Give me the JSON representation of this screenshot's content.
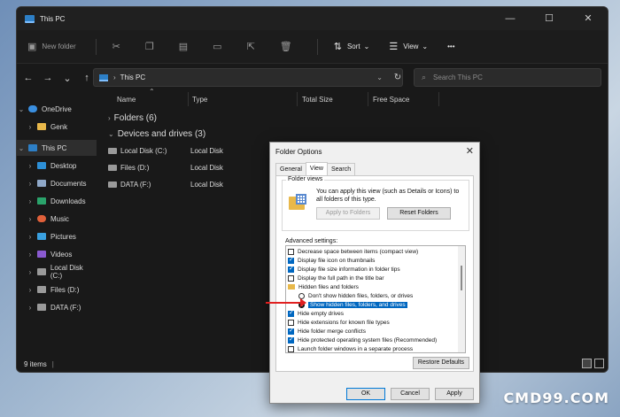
{
  "window": {
    "title": "This PC",
    "controls": [
      "—",
      "☐",
      "✕"
    ]
  },
  "toolbar": {
    "new_folder": "New folder",
    "sort": "Sort",
    "view": "View",
    "more": "•••"
  },
  "address": {
    "path": "This PC",
    "search_placeholder": "Search This PC"
  },
  "sidebar": {
    "items": [
      {
        "label": "OneDrive",
        "icon": "cloud-icon"
      },
      {
        "label": "Genk",
        "icon": "folder-icon"
      },
      {
        "label": "This PC",
        "icon": "computer-icon"
      },
      {
        "label": "Desktop",
        "icon": "desktop-icon"
      },
      {
        "label": "Documents",
        "icon": "documents-icon"
      },
      {
        "label": "Downloads",
        "icon": "download-icon"
      },
      {
        "label": "Music",
        "icon": "music-icon"
      },
      {
        "label": "Pictures",
        "icon": "pictures-icon"
      },
      {
        "label": "Videos",
        "icon": "videos-icon"
      },
      {
        "label": "Local Disk (C:)",
        "icon": "drive-icon"
      },
      {
        "label": "Files (D:)",
        "icon": "drive-icon"
      },
      {
        "label": "DATA (F:)",
        "icon": "drive-icon"
      }
    ]
  },
  "columns": {
    "name": "Name",
    "type": "Type",
    "total_size": "Total Size",
    "free_space": "Free Space"
  },
  "groups": {
    "folders": "Folders (6)",
    "drives": "Devices and drives (3)"
  },
  "drives": [
    {
      "name": "Local Disk (C:)",
      "type": "Local Disk"
    },
    {
      "name": "Files (D:)",
      "type": "Local Disk"
    },
    {
      "name": "DATA (F:)",
      "type": "Local Disk"
    }
  ],
  "status": {
    "items": "9 items"
  },
  "dialog": {
    "title": "Folder Options",
    "tabs": [
      "General",
      "View",
      "Search"
    ],
    "folder_views_legend": "Folder views",
    "folder_views_text": "You can apply this view (such as Details or Icons) to all folders of this type.",
    "apply_to_folders": "Apply to Folders",
    "reset_folders": "Reset Folders",
    "advanced_label": "Advanced settings:",
    "settings": [
      {
        "label": "Decrease space between items (compact view)",
        "kind": "checkbox",
        "checked": false
      },
      {
        "label": "Display file icon on thumbnails",
        "kind": "checkbox",
        "checked": true
      },
      {
        "label": "Display file size information in folder tips",
        "kind": "checkbox",
        "checked": true
      },
      {
        "label": "Display the full path in the title bar",
        "kind": "checkbox",
        "checked": false
      },
      {
        "label": "Hidden files and folders",
        "kind": "folder",
        "checked": false
      },
      {
        "label": "Don't show hidden files, folders, or drives",
        "kind": "radio",
        "checked": false
      },
      {
        "label": "Show hidden files, folders, and drives",
        "kind": "radio",
        "checked": true
      },
      {
        "label": "Hide empty drives",
        "kind": "checkbox",
        "checked": true
      },
      {
        "label": "Hide extensions for known file types",
        "kind": "checkbox",
        "checked": false
      },
      {
        "label": "Hide folder merge conflicts",
        "kind": "checkbox",
        "checked": true
      },
      {
        "label": "Hide protected operating system files (Recommended)",
        "kind": "checkbox",
        "checked": true
      },
      {
        "label": "Launch folder windows in a separate process",
        "kind": "checkbox",
        "checked": false
      }
    ],
    "restore_defaults": "Restore Defaults",
    "ok": "OK",
    "cancel": "Cancel",
    "apply": "Apply"
  },
  "watermark": "CMD99.COM",
  "colors": {
    "accent": "#0067c0",
    "annotation_arrow": "#e02020"
  }
}
